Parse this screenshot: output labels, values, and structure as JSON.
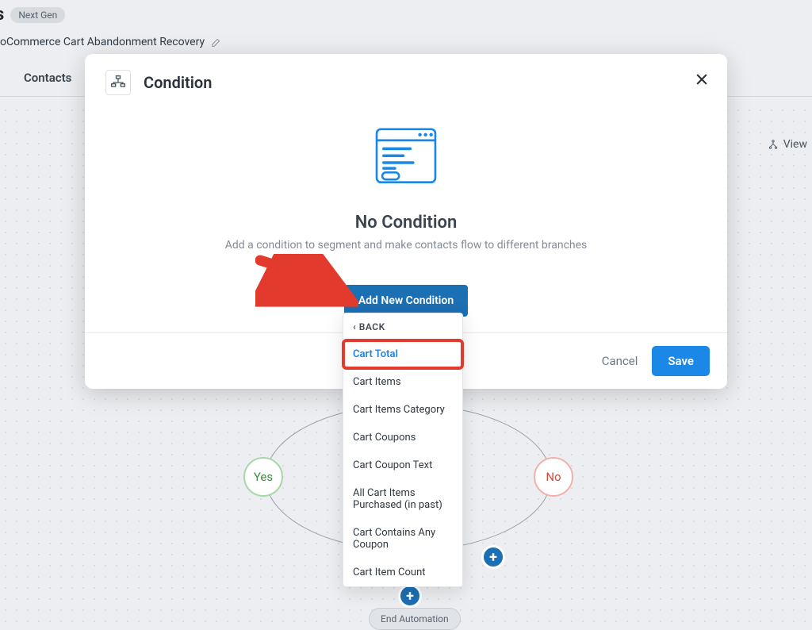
{
  "header": {
    "title_suffix": "s",
    "badge": "Next Gen",
    "breadcrumb": "oCommerce Cart Abandonment Recovery"
  },
  "tabs": {
    "contacts": "Contacts"
  },
  "view_toggle": "View",
  "flow": {
    "yes_label": "Yes",
    "no_label": "No",
    "end_label": "End Automation"
  },
  "modal": {
    "title": "Condition",
    "empty_title": "No Condition",
    "empty_sub": "Add a condition to segment and make contacts flow to different branches",
    "add_button": "Add New Condition",
    "cancel": "Cancel",
    "save": "Save"
  },
  "dropdown": {
    "back": "BACK",
    "items": [
      "Cart Total",
      "Cart Items",
      "Cart Items Category",
      "Cart Coupons",
      "Cart Coupon Text",
      "All Cart Items Purchased (in past)",
      "Cart Contains Any Coupon",
      "Cart Item Count"
    ]
  }
}
